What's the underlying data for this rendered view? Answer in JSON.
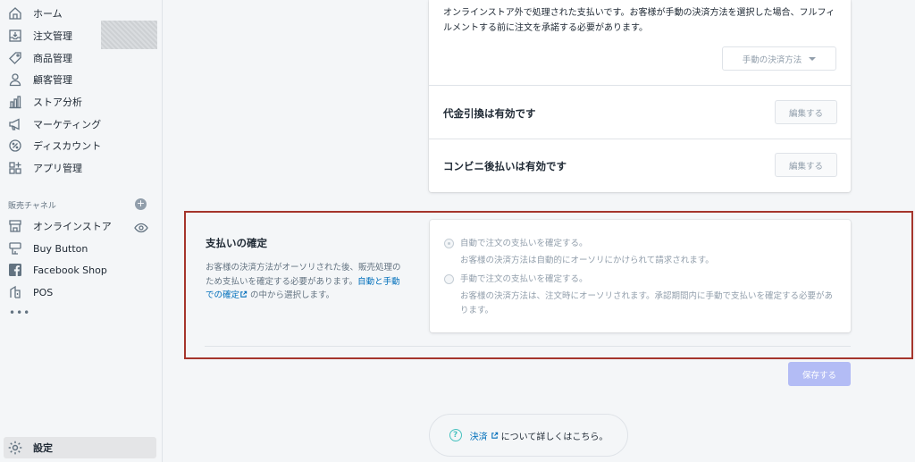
{
  "sidebar": {
    "items": [
      {
        "label": "ホーム"
      },
      {
        "label": "注文管理"
      },
      {
        "label": "商品管理"
      },
      {
        "label": "顧客管理"
      },
      {
        "label": "ストア分析"
      },
      {
        "label": "マーケティング"
      },
      {
        "label": "ディスカウント"
      },
      {
        "label": "アプリ管理"
      }
    ],
    "channels_heading": "販売チャネル",
    "channels_add": "+",
    "channels": [
      {
        "label": "オンラインストア"
      },
      {
        "label": "Buy Button"
      },
      {
        "label": "Facebook Shop"
      },
      {
        "label": "POS"
      }
    ],
    "more": "•••",
    "settings_label": "設定"
  },
  "manual_payments": {
    "description": "オンラインストア外で処理された支払いです。お客様が手動の決済方法を選択した場合、フルフィルメントする前に注文を承諾する必要があります。",
    "dropdown_label": "手動の決済方法",
    "rows": [
      {
        "title": "代金引換は有効です",
        "button": "編集する"
      },
      {
        "title": "コンビニ後払いは有効です",
        "button": "編集する"
      }
    ]
  },
  "payment_capture": {
    "title": "支払いの確定",
    "description_before": "お客様の決済方法がオーソリされた後、販売処理のため支払いを確定する必要があります。",
    "link_text": "自動と手動での確定",
    "description_after": " の中から選択します。",
    "options": [
      {
        "label": "自動で注文の支払いを確定する。",
        "help": "お客様の決済方法は自動的にオーソリにかけられて請求されます。",
        "checked": true
      },
      {
        "label": "手動で注文の支払いを確定する。",
        "help": "お客様の決済方法は、注文時にオーソリされます。承認期間内に手動で支払いを確定する必要があります。",
        "checked": false
      }
    ]
  },
  "save_label": "保存する",
  "learn_more": {
    "link_text": "決済",
    "text": "について詳しくはこちら。"
  },
  "colors": {
    "accent_link": "#006fbb",
    "highlight_border": "#a5352c",
    "save_button_disabled": "#b3bcf5",
    "help_icon": "#47c1bf"
  }
}
